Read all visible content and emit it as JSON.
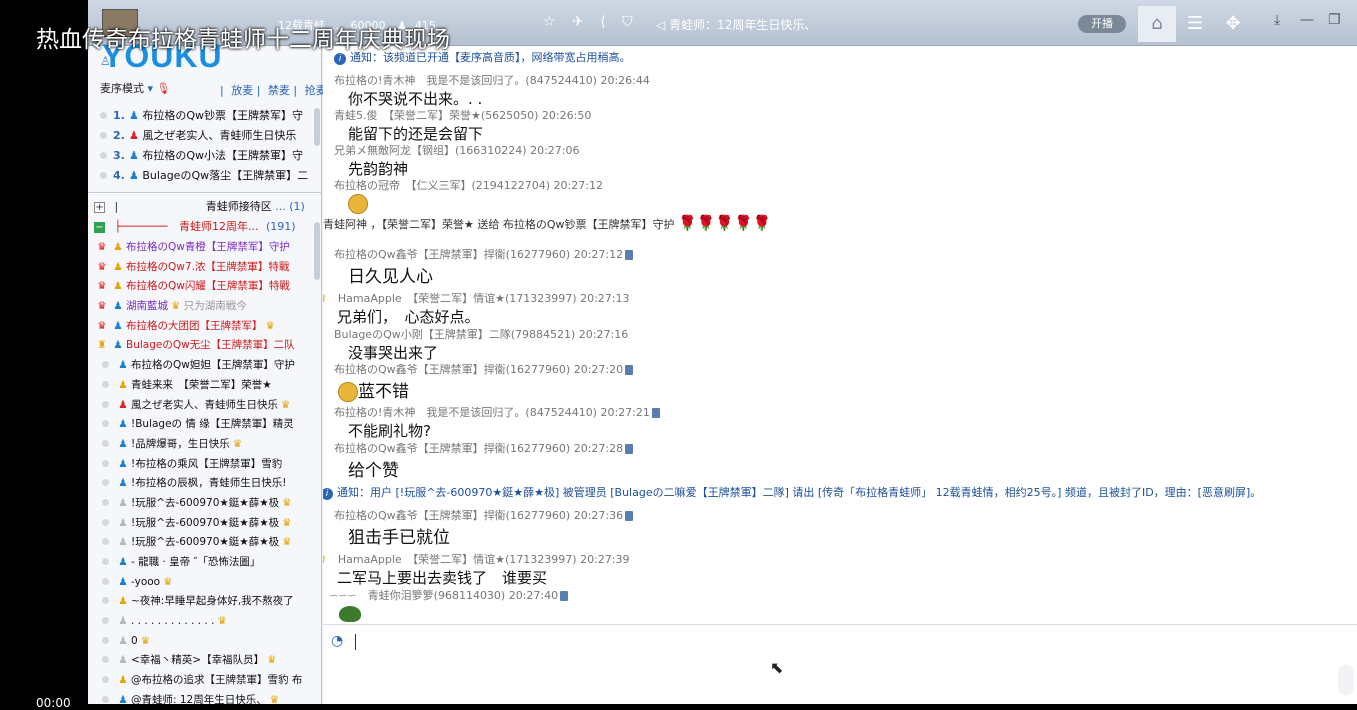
{
  "overlay": {
    "title": "热血传奇布拉格青蛙师十二周年庆典现场",
    "time": "00:00"
  },
  "topbar": {
    "room_name": "12载青蛙 ...",
    "room_id": "60000",
    "fans": "415",
    "bulletin": "青蛙师：12周年生日快乐、",
    "toggle": "开播"
  },
  "left": {
    "logo": "YOUKU",
    "mode_label": "麦序模式",
    "mode_actions": [
      "放麦",
      "禁麦",
      "抢麦"
    ],
    "queue": [
      {
        "num": "1.",
        "text": "布拉格のQw钞票【王牌禁军】守"
      },
      {
        "num": "2.",
        "text": "風之ぜ老实人、青蛙师生日快乐"
      },
      {
        "num": "3.",
        "text": "布拉格のQw小法【王牌禁軍】守"
      },
      {
        "num": "4.",
        "text": "BulageのQw落尘【王牌禁軍】二"
      }
    ],
    "group1": {
      "name": "青蛙师接待区",
      "count": "(1)"
    },
    "group2": {
      "name": "青蛙师12周年...",
      "count": "(191)"
    },
    "members": [
      {
        "text": "布拉格のQw青橙【王牌禁军】守护",
        "style": "purple"
      },
      {
        "text": "布拉格のQw7.浓【王牌禁軍】特戰",
        "style": "red"
      },
      {
        "text": "布拉格のQw闪耀【王牌禁軍】特戰",
        "style": "red"
      },
      {
        "text": "湖南藍城",
        "style": "purple",
        "extra": "只为湖南戦今"
      },
      {
        "text": "布拉格の大团团【王牌禁军】",
        "style": "red"
      },
      {
        "text": "BulageのQw无尘【王牌禁軍】二队",
        "style": "red"
      },
      {
        "text": "布拉格のQw妲妲【王牌禁軍】守护",
        "style": ""
      },
      {
        "text": "青蛙来来　【荣誉二军】荣誉★",
        "style": ""
      },
      {
        "text": "風之ぜ老实人、青蛙师生日快乐",
        "style": ""
      },
      {
        "text": "!Bulageの 情 缘【王牌禁軍】精灵",
        "style": ""
      },
      {
        "text": "!品牌爆哥，生日快乐",
        "style": ""
      },
      {
        "text": "!布拉格の乘风【王牌禁軍】雪豹",
        "style": ""
      },
      {
        "text": "!布拉格の辰枫，青蛙师生日快乐!",
        "style": ""
      },
      {
        "text": "!玩服^去-600970★鋌★薛★极",
        "style": ""
      },
      {
        "text": "!玩服^去-600970★鋌★薛★极",
        "style": ""
      },
      {
        "text": "!玩服^去-600970★鋌★薛★极",
        "style": ""
      },
      {
        "text": "- 龍職 · 皇帝 ″「恐怖法圖」",
        "style": ""
      },
      {
        "text": "-yooo",
        "style": ""
      },
      {
        "text": "~夜神:早睡早起身体好,我不熬夜了",
        "style": ""
      },
      {
        "text": ". . . . . . . . . . . . .",
        "style": ""
      },
      {
        "text": "0",
        "style": ""
      },
      {
        "text": "<幸福丶精英>【幸福队员】",
        "style": ""
      },
      {
        "text": "@布拉格の追求【王牌禁軍】雪豹 布",
        "style": ""
      },
      {
        "text": "@青蛙师: 12周年生日快乐、",
        "style": ""
      }
    ]
  },
  "chat": {
    "notice_top": "通知：该频道已开通【麦序高音质】，网络带宽占用稍高。",
    "messages": [
      {
        "meta": "布拉格の!青木神　我是不是该回归了。(847524410) 20:26:44",
        "body": "你不哭说不出来。. ."
      },
      {
        "meta": "青蛙5.俊　【荣誉二军】荣誉★(5625050) 20:26:50",
        "body": "能留下的还是会留下"
      },
      {
        "meta": "兄弟メ無敵阿龙【钢组】(166310224) 20:27:06",
        "body": "先韵韵神"
      },
      {
        "meta": "布拉格の冠帝　【仁义三军】(2194122704) 20:27:12",
        "body": ""
      },
      {
        "meta": "布拉格のQw鑫爷【王牌禁軍】捍衞(16277960) 20:27:12",
        "body": "日久见人心"
      },
      {
        "meta": "HamaApple　【荣誉二军】情谊★(171323997) 20:27:13",
        "body": "兄弟们，　心态好点。"
      },
      {
        "meta": "BulageのQw小刚【王牌禁軍】二隊(79884521) 20:27:16",
        "body": "没事哭出来了"
      },
      {
        "meta": "布拉格のQw鑫爷【王牌禁軍】捍衞(16277960) 20:27:20",
        "body": "蓝不错"
      },
      {
        "meta": "布拉格の!青木神　我是不是该回归了。(847524410) 20:27:21",
        "body": "不能刷礼物?"
      },
      {
        "meta": "布拉格のQw鑫爷【王牌禁軍】捍衞(16277960) 20:27:28",
        "body": "给个赞"
      },
      {
        "meta": "布拉格のQw鑫爷【王牌禁軍】捍衞(16277960) 20:27:36",
        "body": "狙击手已就位"
      },
      {
        "meta": "HamaApple　【荣誉二军】情谊★(171323997) 20:27:39",
        "body": "二军马上要出去卖钱了　谁要买"
      },
      {
        "meta": "青蛙你泪箩箩(968114030) 20:27:40",
        "body": ""
      }
    ],
    "gift_line": "青蛙阿神 ，【荣誉二军】荣誉★ 送给 布拉格のQw钞票【王牌禁军】守护",
    "notice_kick": "通知：用户 [!玩服^去-600970★鋌★薛★极] 被管理员 [Bulageの二嘛爱【王牌禁軍】二隊] 请出 [传奇「布拉格青蛙师」 12载青蛙情，相约25号。] 频道，且被封了ID，理由：[恶意刷屏]。"
  }
}
